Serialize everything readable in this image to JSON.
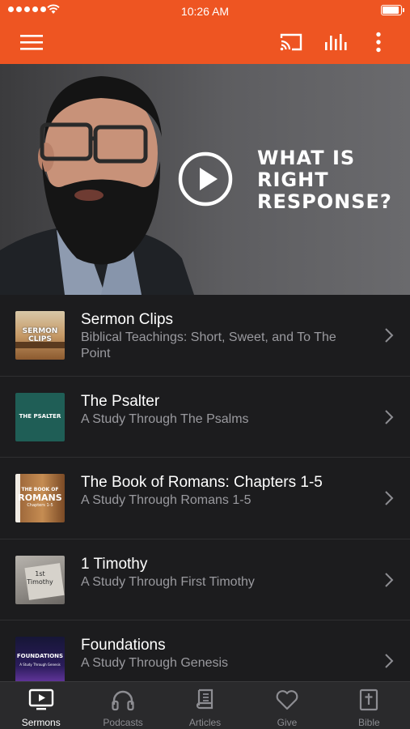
{
  "status_bar": {
    "time": "10:26 AM"
  },
  "header": {
    "icons": [
      "menu-icon",
      "cast-icon",
      "equalizer-icon",
      "more-vertical-icon"
    ],
    "accent_color": "#ee5522"
  },
  "hero": {
    "headline_line1": "WHAT IS",
    "headline_line2": "RIGHT",
    "headline_line3": "RESPONSE?"
  },
  "series": [
    {
      "title": "Sermon Clips",
      "subtitle": "Biblical Teachings: Short, Sweet, and To The Point",
      "thumb_text": "SERMON CLIPS"
    },
    {
      "title": "The Psalter",
      "subtitle": "A Study Through The Psalms",
      "thumb_text": "THE PSALTER"
    },
    {
      "title": "The Book of Romans: Chapters 1-5",
      "subtitle": "A Study Through Romans 1-5",
      "thumb_text_1": "THE BOOK OF",
      "thumb_text_2": "ROMANS",
      "thumb_text_3": "Chapters 1-5"
    },
    {
      "title": "1 Timothy",
      "subtitle": "A Study Through First Timothy",
      "thumb_text_1": "1st",
      "thumb_text_2": "Timothy"
    },
    {
      "title": "Foundations",
      "subtitle": "A Study Through Genesis",
      "thumb_text_1": "FOUNDATIONS",
      "thumb_text_2": "A Study Through Genesis"
    }
  ],
  "tabs": [
    {
      "label": "Sermons",
      "icon": "tv-play-icon",
      "active": true
    },
    {
      "label": "Podcasts",
      "icon": "headphones-icon",
      "active": false
    },
    {
      "label": "Articles",
      "icon": "book-icon",
      "active": false
    },
    {
      "label": "Give",
      "icon": "heart-icon",
      "active": false
    },
    {
      "label": "Bible",
      "icon": "bible-cross-icon",
      "active": false
    }
  ]
}
